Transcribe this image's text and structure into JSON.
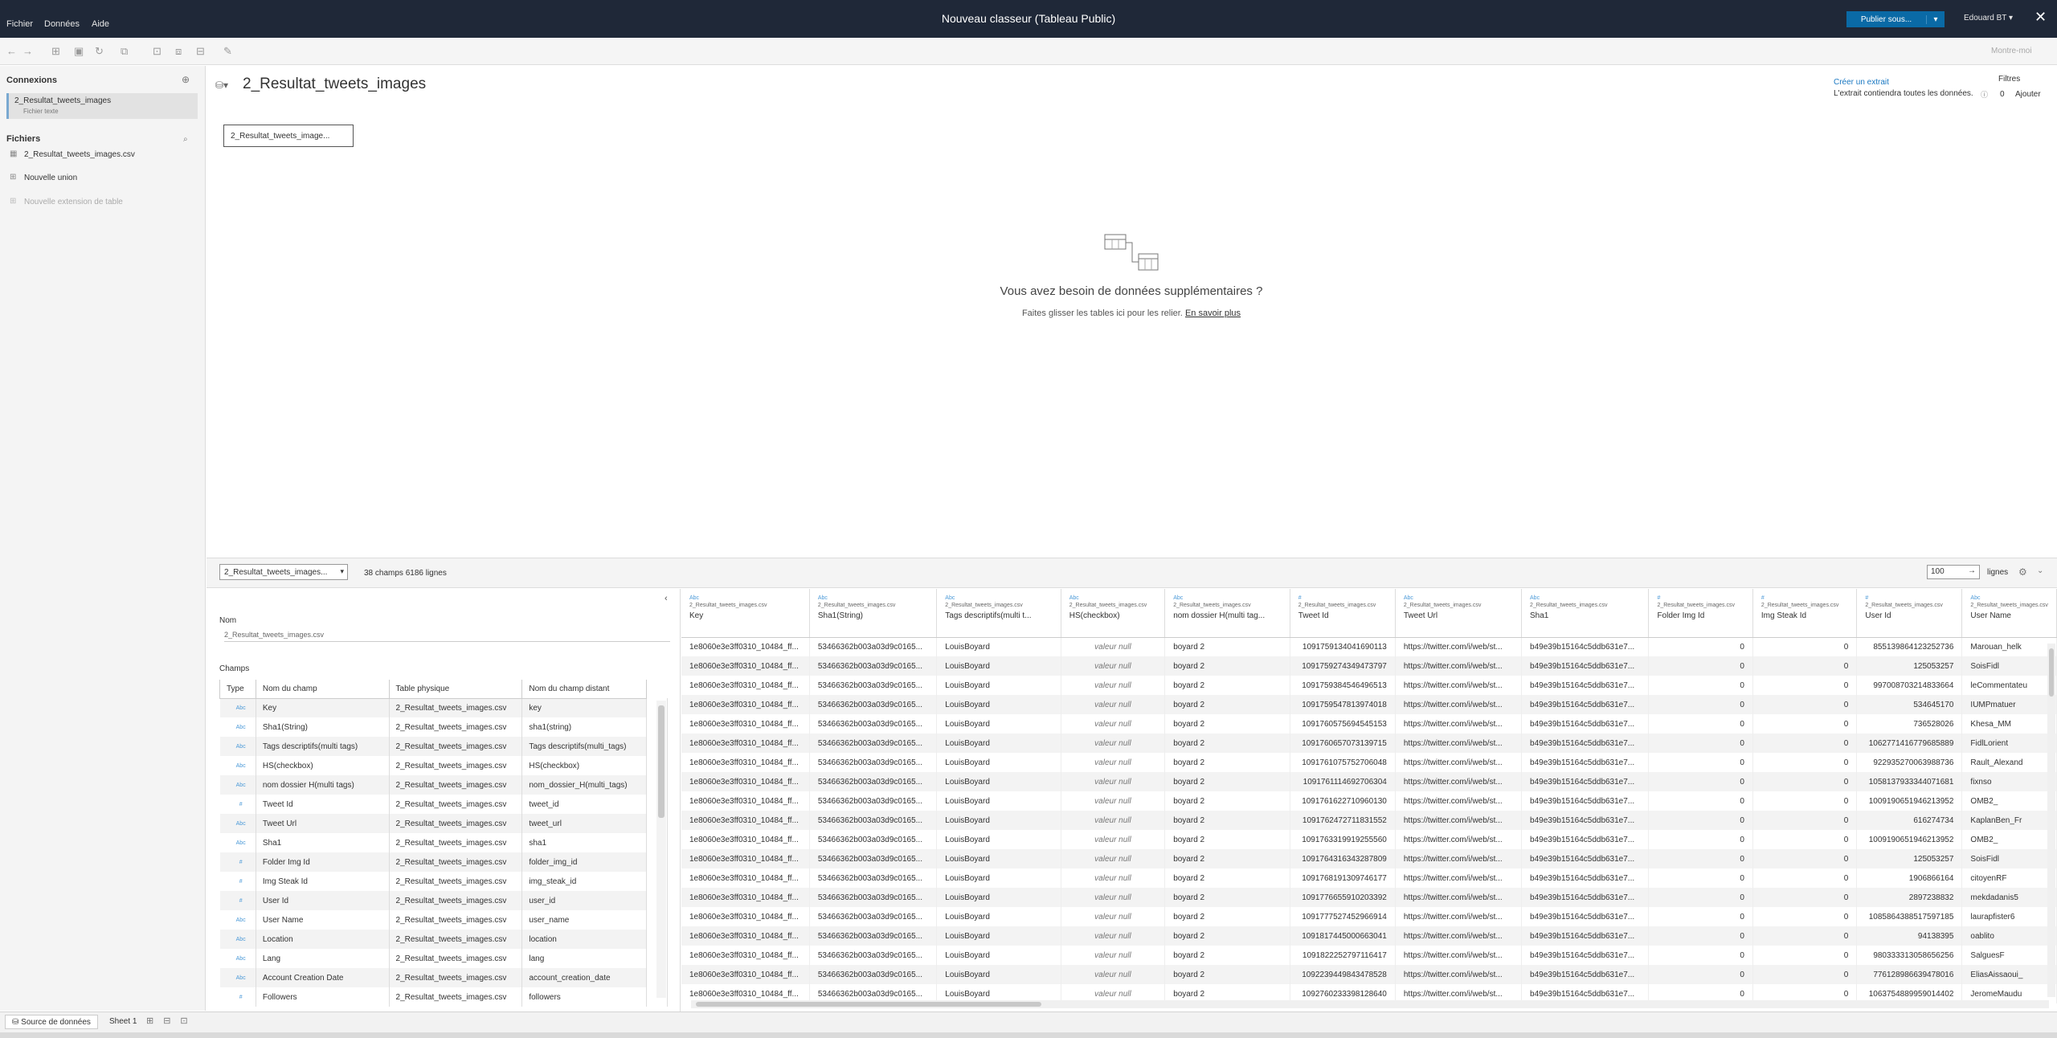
{
  "menu": [
    "Fichier",
    "Données",
    "Aide"
  ],
  "window_title": "Nouveau classeur (Tableau Public)",
  "publish_label": "Publier sous...",
  "user_label": "Edouard BT ▾",
  "montre_moi": "Montre-moi",
  "left": {
    "connexions_heading": "Connexions",
    "connection_name": "2_Resultat_tweets_images",
    "connection_type": "Fichier texte",
    "fichiers_heading": "Fichiers",
    "file_name": "2_Resultat_tweets_images.csv",
    "nouvelle_union": "Nouvelle union",
    "nouvelle_extension": "Nouvelle extension de table"
  },
  "canvas": {
    "title": "2_Resultat_tweets_images",
    "table_box": "2_Resultat_tweets_image...",
    "extract_link": "Créer un extrait",
    "extract_note": "L'extrait contiendra toutes les données.",
    "filtres": "Filtres",
    "filtres_count": "0",
    "filtres_add": "Ajouter",
    "need_more": "Vous avez besoin de données supplémentaires ?",
    "drag_hint": "Faites glisser les tables ici pour les relier.",
    "learn_more": "En savoir plus"
  },
  "preview_bar": {
    "table_select": "2_Resultat_tweets_images...",
    "summary": "38 champs 6186 lignes",
    "rows_value": "100",
    "rows_label": "lignes"
  },
  "metadata": {
    "nom_label": "Nom",
    "nom_value": "2_Resultat_tweets_images.csv",
    "champs_label": "Champs",
    "headers": [
      "Type",
      "Nom du champ",
      "Table physique",
      "Nom du champ distant"
    ],
    "rows": [
      [
        "Abc",
        "Key",
        "2_Resultat_tweets_images.csv",
        "key"
      ],
      [
        "Abc",
        "Sha1(String)",
        "2_Resultat_tweets_images.csv",
        "sha1(string)"
      ],
      [
        "Abc",
        "Tags descriptifs(multi tags)",
        "2_Resultat_tweets_images.csv",
        "Tags descriptifs(multi_tags)"
      ],
      [
        "Abc",
        "HS(checkbox)",
        "2_Resultat_tweets_images.csv",
        "HS(checkbox)"
      ],
      [
        "Abc",
        "nom dossier H(multi tags)",
        "2_Resultat_tweets_images.csv",
        "nom_dossier_H(multi_tags)"
      ],
      [
        "#",
        "Tweet Id",
        "2_Resultat_tweets_images.csv",
        "tweet_id"
      ],
      [
        "Abc",
        "Tweet Url",
        "2_Resultat_tweets_images.csv",
        "tweet_url"
      ],
      [
        "Abc",
        "Sha1",
        "2_Resultat_tweets_images.csv",
        "sha1"
      ],
      [
        "#",
        "Folder Img Id",
        "2_Resultat_tweets_images.csv",
        "folder_img_id"
      ],
      [
        "#",
        "Img Steak Id",
        "2_Resultat_tweets_images.csv",
        "img_steak_id"
      ],
      [
        "#",
        "User Id",
        "2_Resultat_tweets_images.csv",
        "user_id"
      ],
      [
        "Abc",
        "User Name",
        "2_Resultat_tweets_images.csv",
        "user_name"
      ],
      [
        "Abc",
        "Location",
        "2_Resultat_tweets_images.csv",
        "location"
      ],
      [
        "Abc",
        "Lang",
        "2_Resultat_tweets_images.csv",
        "lang"
      ],
      [
        "Abc",
        "Account Creation Date",
        "2_Resultat_tweets_images.csv",
        "account_creation_date"
      ],
      [
        "#",
        "Followers",
        "2_Resultat_tweets_images.csv",
        "followers"
      ]
    ]
  },
  "grid": {
    "source": "2_Resultat_tweets_images.csv",
    "columns": [
      {
        "type": "Abc",
        "name": "Key"
      },
      {
        "type": "Abc",
        "name": "Sha1(String)"
      },
      {
        "type": "Abc",
        "name": "Tags descriptifs(multi t..."
      },
      {
        "type": "Abc",
        "name": "HS(checkbox)"
      },
      {
        "type": "Abc",
        "name": "nom dossier H(multi tag..."
      },
      {
        "type": "#",
        "name": "Tweet Id"
      },
      {
        "type": "Abc",
        "name": "Tweet Url"
      },
      {
        "type": "Abc",
        "name": "Sha1"
      },
      {
        "type": "#",
        "name": "Folder Img Id"
      },
      {
        "type": "#",
        "name": "Img Steak Id"
      },
      {
        "type": "#",
        "name": "User Id"
      },
      {
        "type": "Abc",
        "name": "User Name"
      }
    ],
    "rows": [
      [
        "1e8060e3e3ff0310_10484_ff...",
        "53466362b003a03d9c0165...",
        "LouisBoyard",
        "valeur null",
        "boyard 2",
        "1091759134041690113",
        "https://twitter.com/i/web/st...",
        "b49e39b15164c5ddb631e7...",
        "0",
        "0",
        "855139864123252736",
        "Marouan_helk"
      ],
      [
        "1e8060e3e3ff0310_10484_ff...",
        "53466362b003a03d9c0165...",
        "LouisBoyard",
        "valeur null",
        "boyard 2",
        "1091759274349473797",
        "https://twitter.com/i/web/st...",
        "b49e39b15164c5ddb631e7...",
        "0",
        "0",
        "125053257",
        "SoisFidl"
      ],
      [
        "1e8060e3e3ff0310_10484_ff...",
        "53466362b003a03d9c0165...",
        "LouisBoyard",
        "valeur null",
        "boyard 2",
        "1091759384546496513",
        "https://twitter.com/i/web/st...",
        "b49e39b15164c5ddb631e7...",
        "0",
        "0",
        "997008703214833664",
        "leCommentateu"
      ],
      [
        "1e8060e3e3ff0310_10484_ff...",
        "53466362b003a03d9c0165...",
        "LouisBoyard",
        "valeur null",
        "boyard 2",
        "1091759547813974018",
        "https://twitter.com/i/web/st...",
        "b49e39b15164c5ddb631e7...",
        "0",
        "0",
        "534645170",
        "IUMPmatuer"
      ],
      [
        "1e8060e3e3ff0310_10484_ff...",
        "53466362b003a03d9c0165...",
        "LouisBoyard",
        "valeur null",
        "boyard 2",
        "1091760575694545153",
        "https://twitter.com/i/web/st...",
        "b49e39b15164c5ddb631e7...",
        "0",
        "0",
        "736528026",
        "Khesa_MM"
      ],
      [
        "1e8060e3e3ff0310_10484_ff...",
        "53466362b003a03d9c0165...",
        "LouisBoyard",
        "valeur null",
        "boyard 2",
        "1091760657073139715",
        "https://twitter.com/i/web/st...",
        "b49e39b15164c5ddb631e7...",
        "0",
        "0",
        "1062771416779685889",
        "FidlLorient"
      ],
      [
        "1e8060e3e3ff0310_10484_ff...",
        "53466362b003a03d9c0165...",
        "LouisBoyard",
        "valeur null",
        "boyard 2",
        "1091761075752706048",
        "https://twitter.com/i/web/st...",
        "b49e39b15164c5ddb631e7...",
        "0",
        "0",
        "922935270063988736",
        "Rault_Alexand"
      ],
      [
        "1e8060e3e3ff0310_10484_ff...",
        "53466362b003a03d9c0165...",
        "LouisBoyard",
        "valeur null",
        "boyard 2",
        "1091761114692706304",
        "https://twitter.com/i/web/st...",
        "b49e39b15164c5ddb631e7...",
        "0",
        "0",
        "1058137933344071681",
        "fixnso"
      ],
      [
        "1e8060e3e3ff0310_10484_ff...",
        "53466362b003a03d9c0165...",
        "LouisBoyard",
        "valeur null",
        "boyard 2",
        "1091761622710960130",
        "https://twitter.com/i/web/st...",
        "b49e39b15164c5ddb631e7...",
        "0",
        "0",
        "1009190651946213952",
        "OMB2_"
      ],
      [
        "1e8060e3e3ff0310_10484_ff...",
        "53466362b003a03d9c0165...",
        "LouisBoyard",
        "valeur null",
        "boyard 2",
        "1091762472711831552",
        "https://twitter.com/i/web/st...",
        "b49e39b15164c5ddb631e7...",
        "0",
        "0",
        "616274734",
        "KaplanBen_Fr"
      ],
      [
        "1e8060e3e3ff0310_10484_ff...",
        "53466362b003a03d9c0165...",
        "LouisBoyard",
        "valeur null",
        "boyard 2",
        "1091763319919255560",
        "https://twitter.com/i/web/st...",
        "b49e39b15164c5ddb631e7...",
        "0",
        "0",
        "1009190651946213952",
        "OMB2_"
      ],
      [
        "1e8060e3e3ff0310_10484_ff...",
        "53466362b003a03d9c0165...",
        "LouisBoyard",
        "valeur null",
        "boyard 2",
        "1091764316343287809",
        "https://twitter.com/i/web/st...",
        "b49e39b15164c5ddb631e7...",
        "0",
        "0",
        "125053257",
        "SoisFidl"
      ],
      [
        "1e8060e3e3ff0310_10484_ff...",
        "53466362b003a03d9c0165...",
        "LouisBoyard",
        "valeur null",
        "boyard 2",
        "1091768191309746177",
        "https://twitter.com/i/web/st...",
        "b49e39b15164c5ddb631e7...",
        "0",
        "0",
        "1906866164",
        "citoyenRF"
      ],
      [
        "1e8060e3e3ff0310_10484_ff...",
        "53466362b003a03d9c0165...",
        "LouisBoyard",
        "valeur null",
        "boyard 2",
        "1091776655910203392",
        "https://twitter.com/i/web/st...",
        "b49e39b15164c5ddb631e7...",
        "0",
        "0",
        "2897238832",
        "mekdadanis5"
      ],
      [
        "1e8060e3e3ff0310_10484_ff...",
        "53466362b003a03d9c0165...",
        "LouisBoyard",
        "valeur null",
        "boyard 2",
        "1091777527452966914",
        "https://twitter.com/i/web/st...",
        "b49e39b15164c5ddb631e7...",
        "0",
        "0",
        "1085864388517597185",
        "laurapfister6"
      ],
      [
        "1e8060e3e3ff0310_10484_ff...",
        "53466362b003a03d9c0165...",
        "LouisBoyard",
        "valeur null",
        "boyard 2",
        "1091817445000663041",
        "https://twitter.com/i/web/st...",
        "b49e39b15164c5ddb631e7...",
        "0",
        "0",
        "94138395",
        "oablito"
      ],
      [
        "1e8060e3e3ff0310_10484_ff...",
        "53466362b003a03d9c0165...",
        "LouisBoyard",
        "valeur null",
        "boyard 2",
        "1091822252797116417",
        "https://twitter.com/i/web/st...",
        "b49e39b15164c5ddb631e7...",
        "0",
        "0",
        "980333313058656256",
        "SalguesF"
      ],
      [
        "1e8060e3e3ff0310_10484_ff...",
        "53466362b003a03d9c0165...",
        "LouisBoyard",
        "valeur null",
        "boyard 2",
        "1092239449843478528",
        "https://twitter.com/i/web/st...",
        "b49e39b15164c5ddb631e7...",
        "0",
        "0",
        "776128986639478016",
        "EliasAissaoui_"
      ],
      [
        "1e8060e3e3ff0310_10484_ff...",
        "53466362b003a03d9c0165...",
        "LouisBoyard",
        "valeur null",
        "boyard 2",
        "1092760233398128640",
        "https://twitter.com/i/web/st...",
        "b49e39b15164c5ddb631e7...",
        "0",
        "0",
        "1063754889959014402",
        "JeromeMaudu"
      ]
    ]
  },
  "status": {
    "source_tab": "Source de données",
    "sheet_tab": "Sheet 1"
  }
}
